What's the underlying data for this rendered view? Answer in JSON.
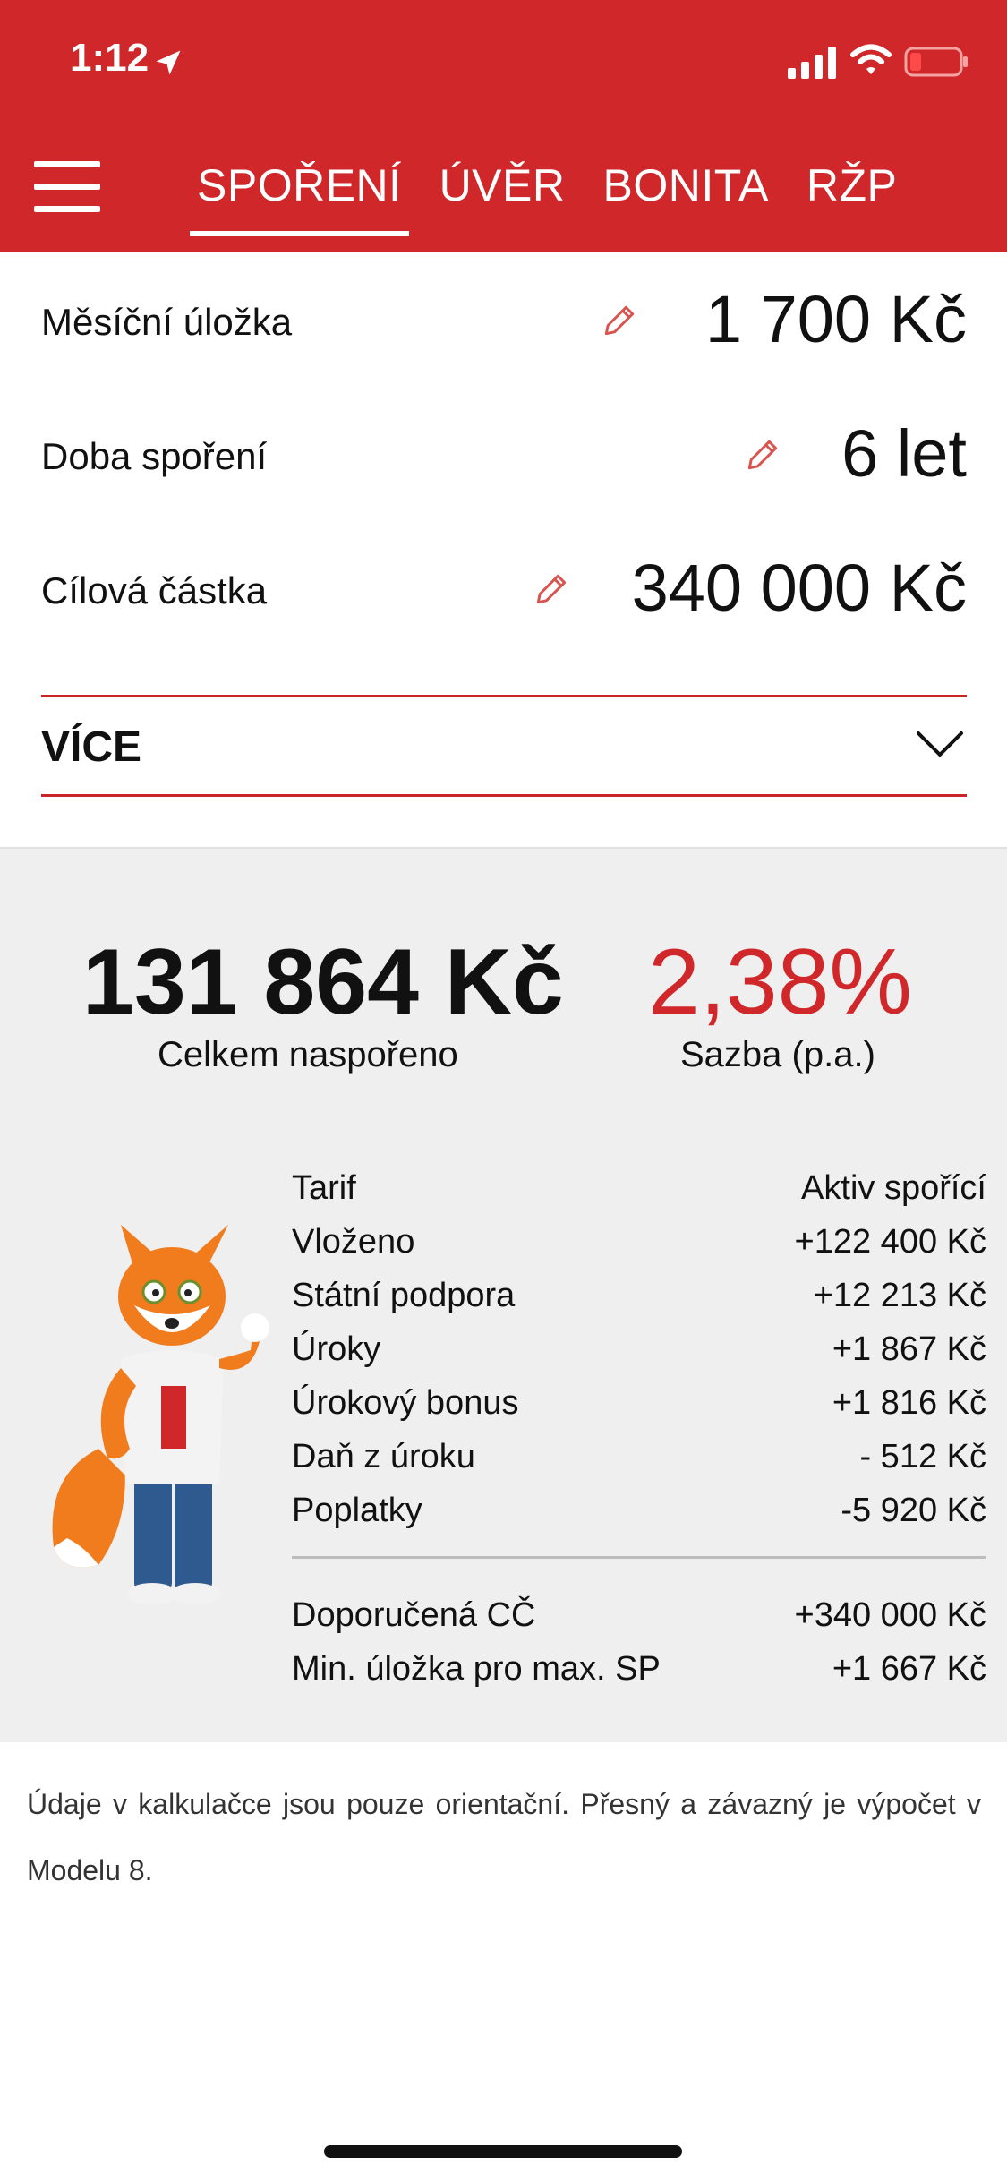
{
  "status_bar": {
    "time": "1:12"
  },
  "nav": {
    "tabs": [
      {
        "label": "SPOŘENÍ",
        "active": true
      },
      {
        "label": "ÚVĚR",
        "active": false
      },
      {
        "label": "BONITA",
        "active": false
      },
      {
        "label": "RŽP",
        "active": false
      }
    ]
  },
  "inputs": {
    "monthly_deposit": {
      "label": "Měsíční úložka",
      "value": "1 700 Kč"
    },
    "saving_period": {
      "label": "Doba spoření",
      "value": "6 let"
    },
    "target_amount": {
      "label": "Cílová částka",
      "value": "340 000 Kč"
    }
  },
  "more": {
    "label": "VÍCE"
  },
  "results": {
    "total": {
      "value": "131 864 Kč",
      "label": "Celkem naspořeno"
    },
    "rate": {
      "value": "2,38%",
      "label": "Sazba (p.a.)"
    },
    "details": [
      {
        "k": "Tarif",
        "v": "Aktiv spořící"
      },
      {
        "k": "Vloženo",
        "v": "+122 400 Kč"
      },
      {
        "k": "Státní podpora",
        "v": "+12 213 Kč"
      },
      {
        "k": "Úroky",
        "v": "+1 867 Kč"
      },
      {
        "k": "Úrokový bonus",
        "v": "+1 816 Kč"
      },
      {
        "k": "Daň z úroku",
        "v": "- 512 Kč"
      },
      {
        "k": "Poplatky",
        "v": "-5 920 Kč"
      }
    ],
    "summary": [
      {
        "k": "Doporučená CČ",
        "v": "+340 000 Kč"
      },
      {
        "k": "Min. úložka pro max. SP",
        "v": "+1 667 Kč"
      }
    ]
  },
  "disclaimer": "Údaje v kalkulačce jsou pouze orientační. Přesný a závazný je výpočet v Modelu 8.",
  "colors": {
    "brand_red": "#d0282a",
    "panel_bg": "#efefef"
  },
  "icons": [
    "location-arrow-icon",
    "signal-icon",
    "wifi-icon",
    "battery-icon",
    "menu-icon",
    "pencil-icon",
    "chevron-down-icon",
    "fox-mascot"
  ]
}
